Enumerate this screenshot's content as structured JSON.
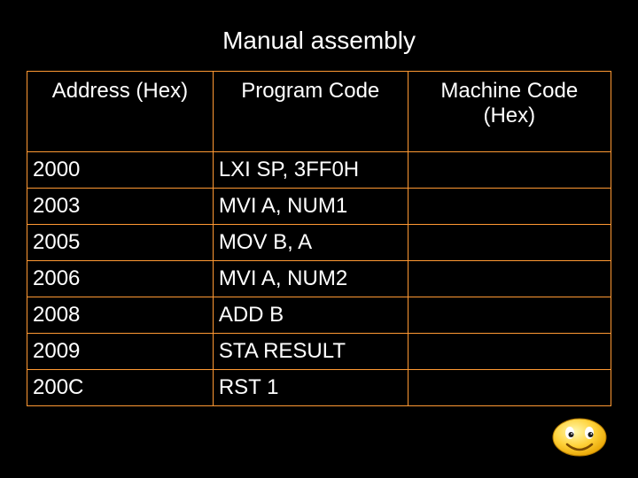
{
  "title": "Manual assembly",
  "headers": {
    "address": "Address (Hex)",
    "program": "Program Code",
    "machine": "Machine Code (Hex)"
  },
  "rows": [
    {
      "address": "2000",
      "program": "LXI SP, 3FF0H",
      "machine": ""
    },
    {
      "address": "2003",
      "program": "MVI A, NUM1",
      "machine": ""
    },
    {
      "address": "2005",
      "program": "MOV B, A",
      "machine": ""
    },
    {
      "address": "2006",
      "program": "MVI A, NUM2",
      "machine": ""
    },
    {
      "address": "2008",
      "program": "ADD B",
      "machine": ""
    },
    {
      "address": "2009",
      "program": "STA RESULT",
      "machine": ""
    },
    {
      "address": "200C",
      "program": "RST 1",
      "machine": ""
    }
  ],
  "icon": "smiley-icon"
}
